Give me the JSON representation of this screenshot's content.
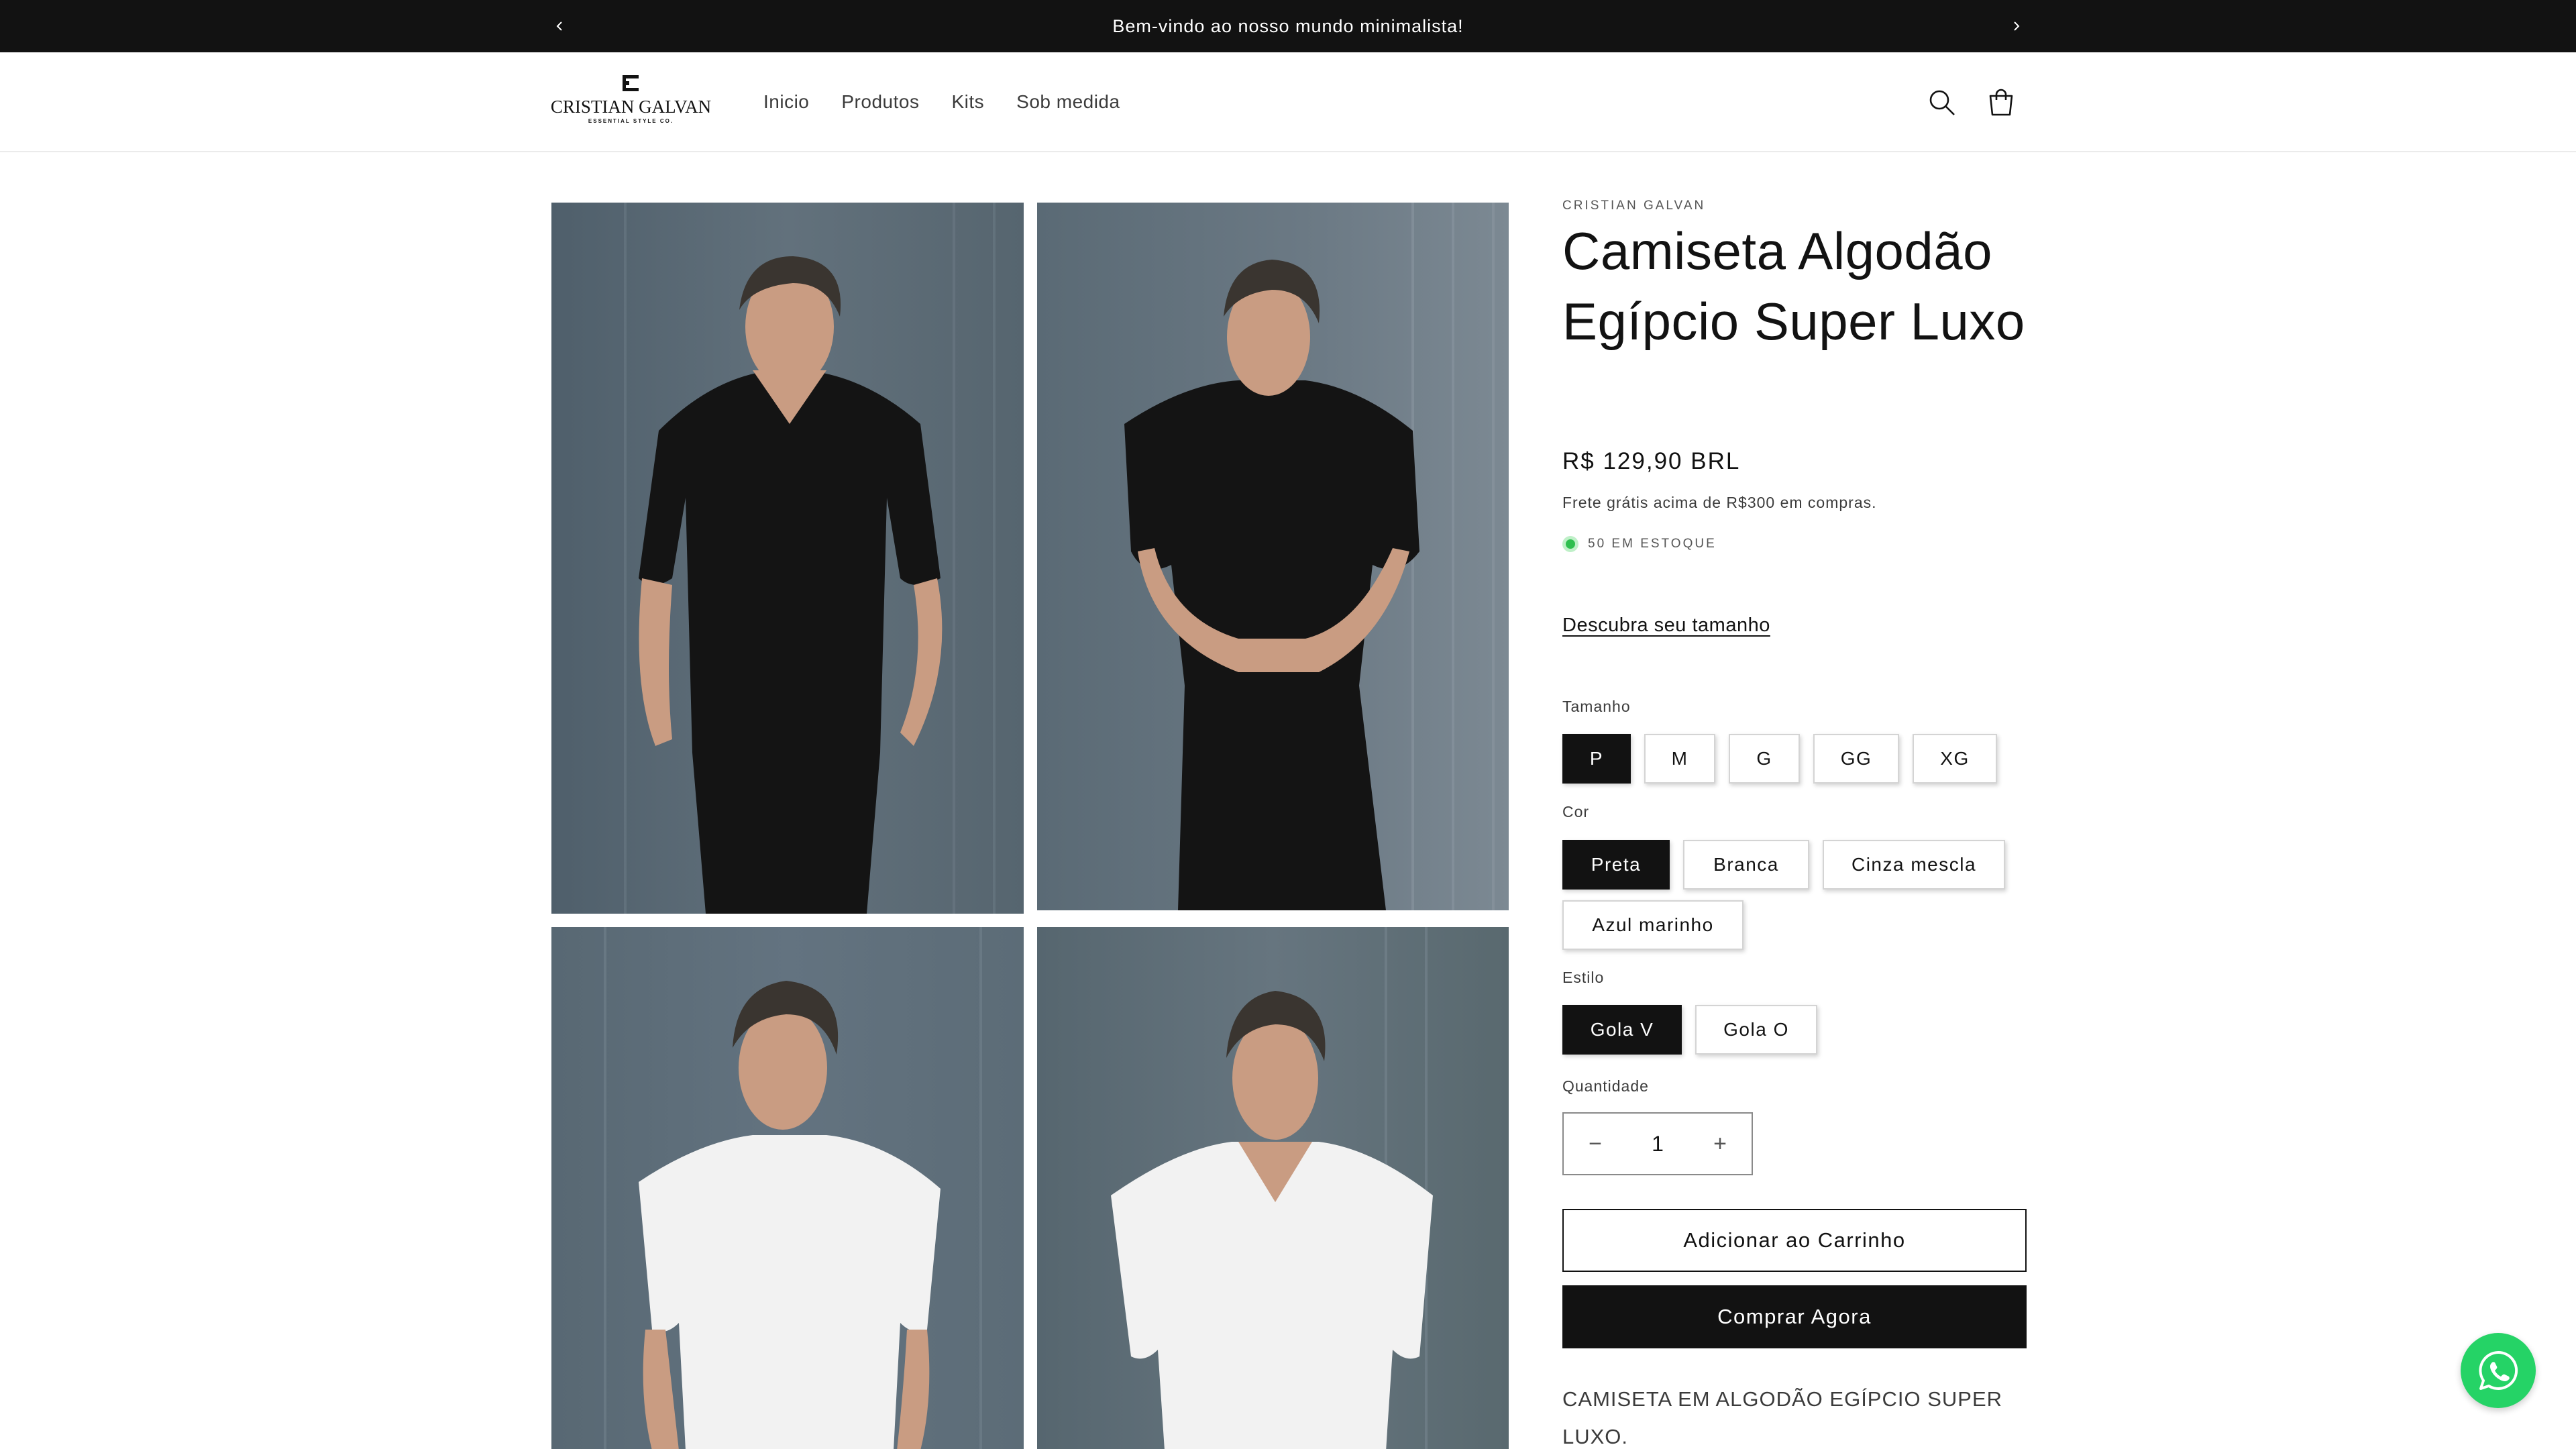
{
  "announcement": {
    "message": "Bem-vindo ao nosso mundo minimalista!",
    "prev_icon": "chevron-left-icon",
    "next_icon": "chevron-right-icon"
  },
  "header": {
    "logo": {
      "brand": "CRISTIAN GALVAN",
      "tagline": "ESSENTIAL STYLE CO."
    },
    "nav": [
      "Inicio",
      "Produtos",
      "Kits",
      "Sob medida"
    ],
    "icons": [
      "search-icon",
      "cart-icon"
    ]
  },
  "gallery": {
    "images": [
      {
        "shirt": "black",
        "neck": "V",
        "alt": ""
      },
      {
        "shirt": "black",
        "neck": "crew",
        "alt": ""
      },
      {
        "shirt": "white",
        "neck": "crew",
        "alt": ""
      },
      {
        "shirt": "white",
        "neck": "V",
        "alt": ""
      }
    ]
  },
  "product": {
    "vendor": "CRISTIAN GALVAN",
    "title": "Camiseta Algodão Egípcio Super Luxo",
    "price": "R$ 129,90 BRL",
    "shipping_note": "Frete grátis acima de R$300 em compras.",
    "stock": "50 EM ESTOQUE",
    "size_guide_link": "Descubra seu tamanho",
    "options": {
      "size": {
        "label": "Tamanho",
        "values": [
          "P",
          "M",
          "G",
          "GG",
          "XG"
        ],
        "selected": "P"
      },
      "color": {
        "label": "Cor",
        "values": [
          "Preta",
          "Branca",
          "Cinza mescla",
          "Azul marinho"
        ],
        "selected": "Preta"
      },
      "style": {
        "label": "Estilo",
        "values": [
          "Gola V",
          "Gola O"
        ],
        "selected": "Gola V"
      }
    },
    "quantity": {
      "label": "Quantidade",
      "value": "1",
      "minus": "−",
      "plus": "+"
    },
    "add_to_cart": "Adicionar ao Carrinho",
    "buy_now": "Comprar Agora",
    "description_start": "CAMISETA EM ALGODÃO EGÍPCIO SUPER LUXO."
  },
  "floating": {
    "icon": "whatsapp-icon"
  },
  "colors": {
    "dark": "#121212",
    "accent_green": "#25d366",
    "stock_green": "#2fbf4f"
  }
}
